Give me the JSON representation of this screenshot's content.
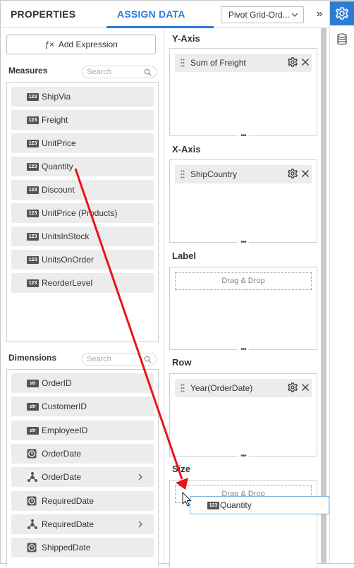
{
  "tabs": {
    "properties": "PROPERTIES",
    "assign_data": "ASSIGN DATA"
  },
  "datasource": {
    "selected": "Pivot Grid-Ord..."
  },
  "toolbar": {
    "collapse_glyph": "»"
  },
  "add_expression": {
    "icon_text": "ƒ×",
    "label": "Add Expression"
  },
  "measures": {
    "title": "Measures",
    "search_placeholder": "Search",
    "items": [
      {
        "type": "123",
        "label": "ShipVia"
      },
      {
        "type": "123",
        "label": "Freight"
      },
      {
        "type": "123",
        "label": "UnitPrice"
      },
      {
        "type": "123",
        "label": "Quantity"
      },
      {
        "type": "123",
        "label": "Discount"
      },
      {
        "type": "123",
        "label": "UnitPrice (Products)"
      },
      {
        "type": "123",
        "label": "UnitsInStock"
      },
      {
        "type": "123",
        "label": "UnitsOnOrder"
      },
      {
        "type": "123",
        "label": "ReorderLevel"
      }
    ]
  },
  "dimensions": {
    "title": "Dimensions",
    "search_placeholder": "Search",
    "items": [
      {
        "type": "str",
        "label": "OrderID"
      },
      {
        "type": "str",
        "label": "CustomerID"
      },
      {
        "type": "str",
        "label": "EmployeeID"
      },
      {
        "type": "date",
        "label": "OrderDate"
      },
      {
        "type": "hier",
        "label": "OrderDate"
      },
      {
        "type": "date",
        "label": "RequiredDate"
      },
      {
        "type": "hier",
        "label": "RequiredDate"
      },
      {
        "type": "date",
        "label": "ShippedDate"
      }
    ]
  },
  "sections": {
    "y_axis": {
      "title": "Y-Axis",
      "chip": "Sum of Freight"
    },
    "x_axis": {
      "title": "X-Axis",
      "chip": "ShipCountry"
    },
    "label": {
      "title": "Label",
      "placeholder": "Drag & Drop"
    },
    "row": {
      "title": "Row",
      "chip": "Year(OrderDate)"
    },
    "size": {
      "title": "Size",
      "placeholder": "Drag & Drop"
    }
  },
  "drag_ghost": {
    "type": "123",
    "label": "Quantity"
  },
  "colors": {
    "accent": "#2b7cd3",
    "arrow": "#e8141b",
    "chip_bg": "#ececec"
  }
}
